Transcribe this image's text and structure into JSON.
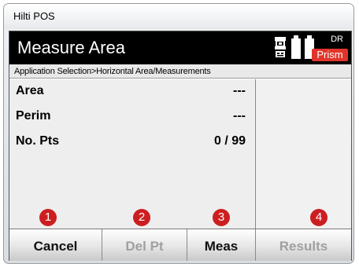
{
  "window": {
    "title": "Hilti POS"
  },
  "header": {
    "title": "Measure Area",
    "mode": "DR",
    "target": "Prism"
  },
  "breadcrumb": "Application Selection>Horizontal Area/Measurements",
  "measurements": [
    {
      "label": "Area",
      "value": "---"
    },
    {
      "label": "Perim",
      "value": "---"
    },
    {
      "label": "No. Pts",
      "value": "0 / 99"
    }
  ],
  "softkeys": [
    {
      "label": "Cancel",
      "number": "1",
      "enabled": true
    },
    {
      "label": "Del Pt",
      "number": "2",
      "enabled": false
    },
    {
      "label": "Meas",
      "number": "3",
      "enabled": true
    },
    {
      "label": "Results",
      "number": "4",
      "enabled": false
    }
  ],
  "colors": {
    "header_bg": "#000000",
    "prism_badge": "#e1352b",
    "callout_badge": "#cc1e20",
    "disabled_text": "#a0a0a0"
  },
  "icons": {
    "instrument": "total-station-icon",
    "battery": "battery-icon"
  }
}
